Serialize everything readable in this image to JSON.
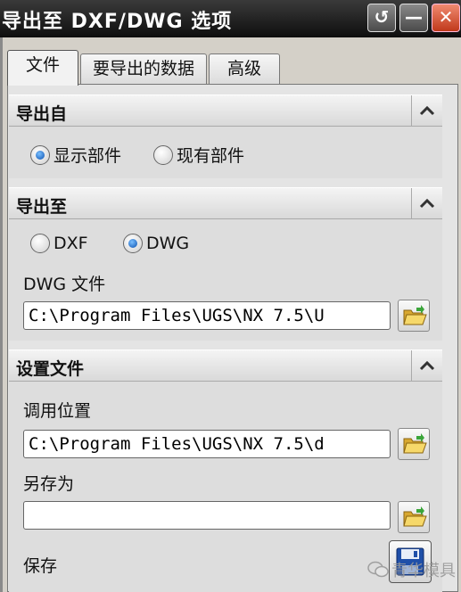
{
  "window": {
    "title": "导出至 DXF/DWG 选项",
    "controls": {
      "restore_icon": "↺",
      "minimize_icon": "—",
      "close_icon": "✕"
    }
  },
  "tabs": [
    {
      "label": "文件",
      "active": true
    },
    {
      "label": "要导出的数据",
      "active": false
    },
    {
      "label": "高级",
      "active": false
    }
  ],
  "sections": {
    "export_from": {
      "title": "导出自",
      "options": [
        {
          "label": "显示部件",
          "selected": true
        },
        {
          "label": "现有部件",
          "selected": false
        }
      ]
    },
    "export_to": {
      "title": "导出至",
      "options": [
        {
          "label": "DXF",
          "selected": false
        },
        {
          "label": "DWG",
          "selected": true
        }
      ],
      "file_label": "DWG 文件",
      "file_value": "C:\\Program Files\\UGS\\NX 7.5\\U"
    },
    "settings_file": {
      "title": "设置文件",
      "load_label": "调用位置",
      "load_value": "C:\\Program Files\\UGS\\NX 7.5\\d",
      "saveas_label": "另存为",
      "saveas_value": "",
      "save_label": "保存"
    }
  },
  "watermark": "青华模具",
  "colors": {
    "titlebar": "#1a1a1a",
    "radio_selected": "#0a4fb0",
    "close_button": "#c0391b"
  },
  "icons": {
    "collapse": "chevron-up-icon",
    "browse": "folder-open-icon",
    "save": "floppy-disk-icon"
  }
}
